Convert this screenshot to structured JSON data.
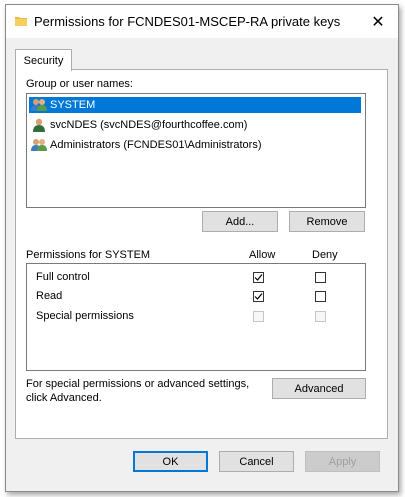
{
  "window": {
    "title": "Permissions for FCNDES01-MSCEP-RA private keys",
    "close_glyph": "✕"
  },
  "tabs": [
    {
      "label": "Security"
    }
  ],
  "group_section": {
    "label": "Group or user names:",
    "items": [
      {
        "label": "SYSTEM",
        "icon": "users-icon",
        "selected": true
      },
      {
        "label": "svcNDES (svcNDES@fourthcoffee.com)",
        "icon": "user-icon",
        "selected": false
      },
      {
        "label": "Administrators (FCNDES01\\Administrators)",
        "icon": "users-icon",
        "selected": false
      }
    ],
    "add_button": "Add...",
    "remove_button": "Remove"
  },
  "permissions": {
    "label": "Permissions for SYSTEM",
    "allow_header": "Allow",
    "deny_header": "Deny",
    "rows": [
      {
        "name": "Full control",
        "allow": true,
        "deny": false,
        "enabled": true
      },
      {
        "name": "Read",
        "allow": true,
        "deny": false,
        "enabled": true
      },
      {
        "name": "Special permissions",
        "allow": false,
        "deny": false,
        "enabled": false
      }
    ]
  },
  "advanced": {
    "text_line1": "For special permissions or advanced settings,",
    "text_line2": "click Advanced.",
    "button": "Advanced"
  },
  "footer": {
    "ok": "OK",
    "cancel": "Cancel",
    "apply": "Apply"
  },
  "colors": {
    "selection": "#0078d7",
    "dialog_bg": "#f0f0f0",
    "button_bg": "#e1e1e1"
  }
}
